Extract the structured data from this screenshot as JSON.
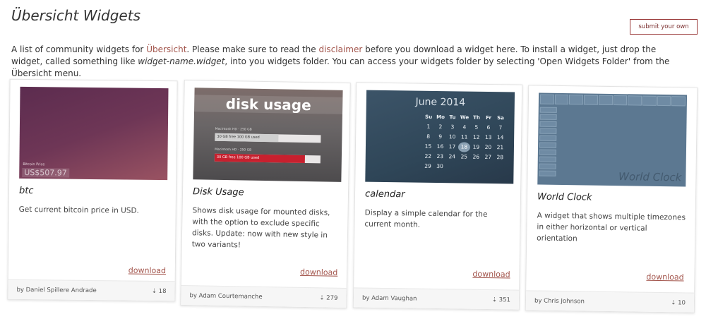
{
  "header": {
    "title": "Übersicht Widgets",
    "submit_label": "submit your own"
  },
  "intro": {
    "p1": "A list of community widgets for ",
    "link_ubersicht": "Übersicht",
    "p2": ". Please make sure to read the ",
    "link_disclaimer": "disclaimer",
    "p3": " before you download a widget here. To install a widget, just drop the widget, called something like ",
    "widget_filename": "widget-name.widget",
    "p4": ", into you widgets folder. You can access your widgets folder by selecting 'Open Widgets Folder' from the Übersicht menu."
  },
  "widgets": [
    {
      "name": "btc",
      "description": "Get current bitcoin price in USD.",
      "download_label": "download",
      "author": "by Daniel Spillere Andrade",
      "downloads": "⇣ 18",
      "thumb": {
        "label": "Bitcoin Price",
        "value": "US$507.97"
      }
    },
    {
      "name": "Disk Usage",
      "description": "Shows disk usage for mounted disks, with the option to exclude specific disks. Update: now with new style in two variants!",
      "download_label": "download",
      "author": "by Adam Courtemanche",
      "downloads": "⇣ 279",
      "thumb": {
        "title": "disk usage",
        "disk1_label": "Macintosh HD · 250 GB",
        "disk1_text": "30 GB free 100 GB used",
        "disk1_used": 0.6,
        "disk2_label": "Macintosh HD · 250 GB",
        "disk2_text": "30 GB free 100 GB used",
        "disk2_used": 0.85
      }
    },
    {
      "name": "calendar",
      "description": "Display a simple calendar for the current month.",
      "download_label": "download",
      "author": "by Adam Vaughan",
      "downloads": "⇣ 351",
      "thumb": {
        "month": "June 2014",
        "weekdays": [
          "Su",
          "Mo",
          "Tu",
          "We",
          "Th",
          "Fr",
          "Sa"
        ],
        "weeks": [
          [
            "1",
            "2",
            "3",
            "4",
            "5",
            "6",
            "7"
          ],
          [
            "8",
            "9",
            "10",
            "11",
            "12",
            "13",
            "14"
          ],
          [
            "15",
            "16",
            "17",
            "18",
            "19",
            "20",
            "21"
          ],
          [
            "22",
            "23",
            "24",
            "25",
            "26",
            "27",
            "28"
          ],
          [
            "29",
            "30",
            "",
            "",
            "",
            "",
            ""
          ]
        ],
        "today": "18"
      }
    },
    {
      "name": "World Clock",
      "description": "A widget that shows multiple timezones in either horizontal or vertical orientation",
      "download_label": "download",
      "author": "by Chris Johnson",
      "downloads": "⇣ 10",
      "thumb": {
        "watermark": "World Clock"
      }
    }
  ],
  "colors": {
    "accent": "#a2544b",
    "btc_bg": "#6e3656",
    "disk_bar_used_1": "#d0d0d0",
    "disk_bar_used_2": "#c8202e",
    "calendar_bg": "#34495b",
    "worldclock_bg": "#5c7891"
  }
}
